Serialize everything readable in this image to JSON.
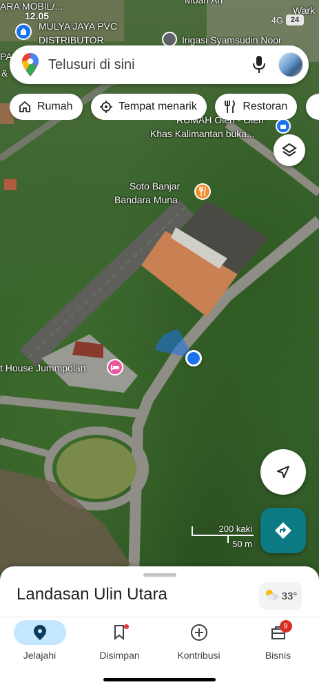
{
  "status": {
    "time": "12.05",
    "network": "4G",
    "battery": "24"
  },
  "search": {
    "placeholder": "Telusuri di sini"
  },
  "chips": [
    {
      "label": "Rumah",
      "icon": "home-icon"
    },
    {
      "label": "Tempat menarik",
      "icon": "attraction-icon"
    },
    {
      "label": "Restoran",
      "icon": "restaurant-icon"
    }
  ],
  "map": {
    "labels": {
      "mobil": "ARA MOBIL/...",
      "mulya1": "MULYA JAYA PVC",
      "mulya2": "DISTRIBUTOR",
      "irigasi": "Irigasi Syamsudin Noor",
      "mbah": "Mbah Ari",
      "wark": "Wark",
      "pa": "PA",
      "amp": "&",
      "rumah1": "RUMAH Oleh - Oleh",
      "rumah2": "Khas Kalimantan buka...",
      "soto1": "Soto Banjar",
      "soto2": "Bandara Muna",
      "house": "t House Jummpolan"
    },
    "scale": {
      "imperial": "200 kaki",
      "metric": "50 m"
    }
  },
  "sheet": {
    "title": "Landasan Ulin Utara",
    "temperature": "33°"
  },
  "nav": [
    {
      "label": "Jelajahi",
      "icon": "explore-pin-icon",
      "active": true
    },
    {
      "label": "Disimpan",
      "icon": "bookmark-icon"
    },
    {
      "label": "Kontribusi",
      "icon": "add-circle-icon"
    },
    {
      "label": "Bisnis",
      "icon": "store-icon",
      "badge": "9"
    }
  ],
  "colors": {
    "accent": "#1a73e8",
    "directions": "#0b7a83",
    "active_nav": "#c2e7ff",
    "badge": "#d93025"
  }
}
